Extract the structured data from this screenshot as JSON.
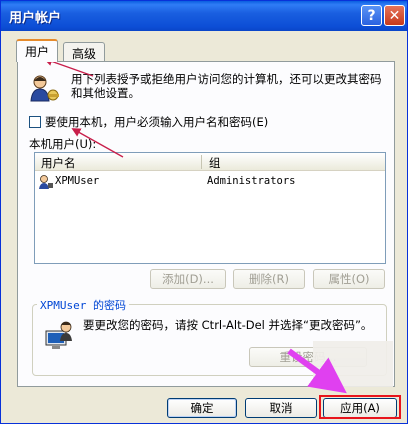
{
  "window": {
    "title": "用户帐户"
  },
  "titlebar": {
    "help_glyph": "?",
    "close_glyph": "✕"
  },
  "tabs": [
    {
      "label": "用户",
      "active": true
    },
    {
      "label": "高级",
      "active": false
    }
  ],
  "users_tab": {
    "intro_text": "用下列表授予或拒绝用户访问您的计算机，还可以更改其密码和其他设置。",
    "require_login_checkbox": {
      "label": "要使用本机，用户必须输入用户名和密码(E)",
      "checked": false
    },
    "local_users_label": "本机用户(U):",
    "columns": [
      "用户名",
      "组"
    ],
    "rows": [
      {
        "user": "XPMUser",
        "group": "Administrators"
      }
    ],
    "buttons": {
      "add": "添加(D)...",
      "remove": "删除(R)",
      "properties": "属性(O)"
    },
    "password_group": {
      "title": "XPMUser 的密码",
      "text": "要更改您的密码，请按 Ctrl-Alt-Del 并选择“更改密码”。",
      "reset_button": "重设密码..."
    }
  },
  "footer": {
    "ok": "确定",
    "cancel": "取消",
    "apply": "应用(A)"
  },
  "colors": {
    "annotation_arrow": "#c81e4a",
    "highlight_arrow": "#e040f0",
    "highlight_box": "#e8141b"
  }
}
